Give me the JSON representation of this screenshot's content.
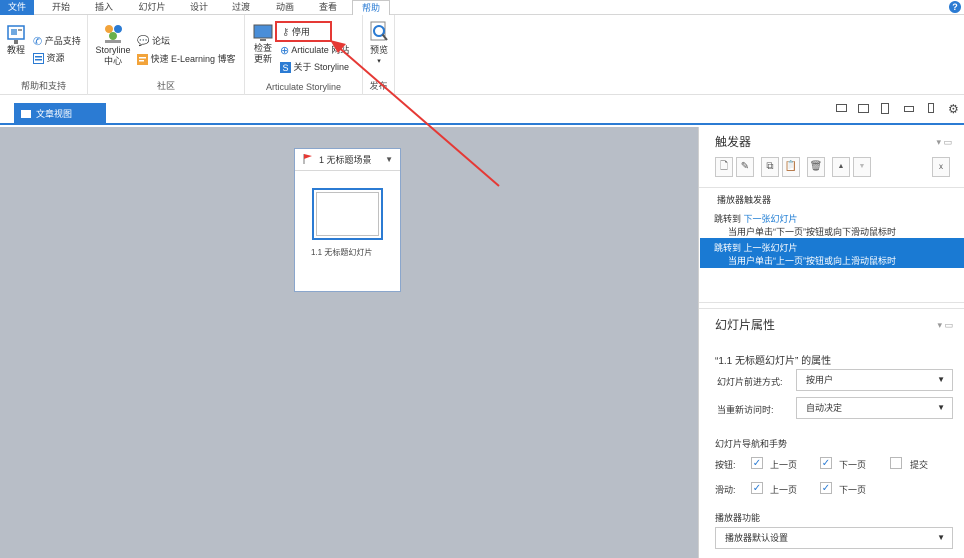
{
  "ribbon_tabs": [
    "文件",
    "开始",
    "插入",
    "幻灯片",
    "设计",
    "过渡",
    "动画",
    "查看",
    "帮助"
  ],
  "help_badge": "?",
  "ribbon": {
    "help_group": {
      "tutorial": "教程",
      "product_support": "产品支持",
      "resources": "资源",
      "label": "帮助和支持"
    },
    "community_group": {
      "storyline_center_1": "Storyline",
      "storyline_center_2": "中心",
      "forum": "论坛",
      "elearning_blog": "快速 E-Learning 博客",
      "label": "社区"
    },
    "articulate_group": {
      "check_updates_1": "检查",
      "check_updates_2": "更新",
      "deactivate": "停用",
      "articulate_web": "Articulate 网站",
      "about": "关于 Storyline",
      "label": "Articulate Storyline"
    },
    "publish_group": {
      "preview": "预览",
      "label": "发布"
    }
  },
  "view_tab": "文章视图",
  "scene": {
    "title": "1 无标题场景",
    "slide_caption": "1.1 无标题幻灯片"
  },
  "triggers": {
    "title": "触发器",
    "player_triggers": "播放器触发器",
    "item1_action": "跳转到",
    "item1_target": "下一张幻灯片",
    "item1_cond": "当用户单击“下一页”按钮或向下滑动鼠标时",
    "item2_action": "跳转到",
    "item2_target": "上一张幻灯片",
    "item2_cond": "当用户单击“上一页”按钮或向上滑动鼠标时"
  },
  "slide_props": {
    "title": "幻灯片属性",
    "props_of": "“1.1 无标题幻灯片” 的属性",
    "advance_label": "幻灯片前进方式:",
    "advance_value": "按用户",
    "revisit_label": "当重新访问时:",
    "revisit_value": "自动决定",
    "nav_title": "幻灯片导航和手势",
    "buttons_label": "按钮:",
    "swipe_label": "滑动:",
    "prev": "上一页",
    "next": "下一页",
    "submit": "提交",
    "player_title": "播放器功能",
    "player_value": "播放器默认设置"
  },
  "colors": {
    "accent": "#2b7bd3",
    "highlight": "#e53935",
    "canvas": "#b8bec7"
  }
}
